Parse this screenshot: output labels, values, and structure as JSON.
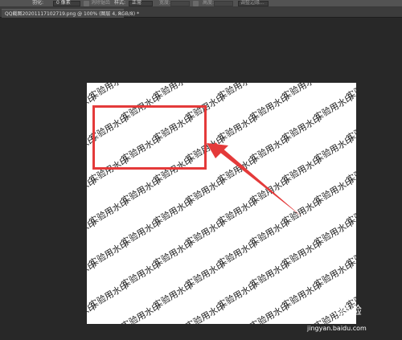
{
  "options_bar": {
    "items": [
      {
        "label": "羽化:"
      },
      {
        "label": "0 像素"
      },
      {
        "label": "消除锯齿"
      },
      {
        "label": "样式:"
      },
      {
        "label": "正常"
      },
      {
        "label": "宽度:"
      },
      {
        "label": "高度:"
      },
      {
        "label": "调整边缘..."
      }
    ]
  },
  "document_tab": {
    "label": "QQ截图20201117102719.png @ 100% (图层 4, RGB/8) *",
    "close": "×"
  },
  "canvas": {
    "watermark_text": "实验用水印"
  },
  "annotation": {
    "color": "#e43a3a"
  },
  "site_watermark": {
    "logo": "Baidu经验",
    "url": "jingyan.baidu.com"
  }
}
